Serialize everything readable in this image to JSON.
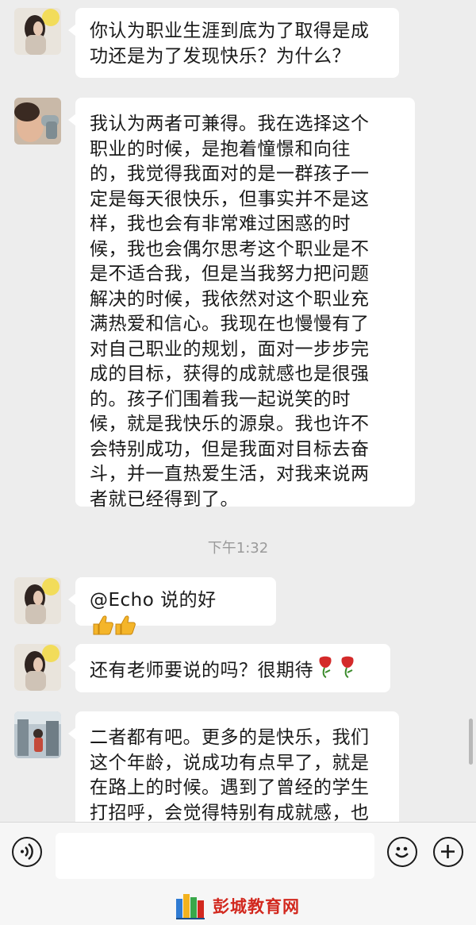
{
  "messages": [
    {
      "avatar": "girl-profile-avatar",
      "lines": [
        "你认为职业生涯到底为了取得是成",
        "功还是为了发现快乐？为什么？"
      ]
    },
    {
      "avatar": "child-drinking-avatar",
      "lines": [
        "我认为两者可兼得。我在选择这个",
        "职业的时候，是抱着憧憬和向往",
        "的，我觉得我面对的是一群孩子一",
        "定是每天很快乐，但事实并不是这",
        "样，我也会有非常难过困惑的时",
        "候，我也会偶尔思考这个职业是不",
        "是不适合我，但是当我努力把问题",
        "解决的时候，我依然对这个职业充",
        "满热爱和信心。我现在也慢慢有了",
        "对自己职业的规划，面对一步步完",
        "成的目标，获得的成就感也是很强",
        "的。孩子们围着我一起说笑的时",
        "候，就是我快乐的源泉。我也许不",
        "会特别成功，但是我面对目标去奋",
        "斗，并一直热爱生活，对我来说两",
        "者就已经得到了。"
      ]
    },
    {
      "avatar": "girl-profile-avatar",
      "text": "@Echo 说的好",
      "emoji": "thumbs-up-icon"
    },
    {
      "avatar": "girl-profile-avatar",
      "text": "还有老师要说的吗？很期待",
      "emoji": "rose-icon"
    },
    {
      "avatar": "street-photo-avatar",
      "lines": [
        "二者都有吧。更多的是快乐，我们",
        "这个年龄，说成功有点早了，就是",
        "在路上的时候。遇到了曾经的学生",
        "打招呼，会觉得特别有成就感，也"
      ]
    }
  ],
  "timestamp": "下午1:32",
  "input": {
    "voice_icon": "voice-icon",
    "emoji_icon": "emoji-icon",
    "plus_icon": "plus-icon",
    "value": ""
  },
  "watermark": {
    "text": "彭城教育网",
    "logo": "books-logo-icon"
  },
  "colors": {
    "background": "#ededed",
    "bubble": "#ffffff",
    "timestamp": "#9a9a9a",
    "brand": "#d2281e"
  }
}
